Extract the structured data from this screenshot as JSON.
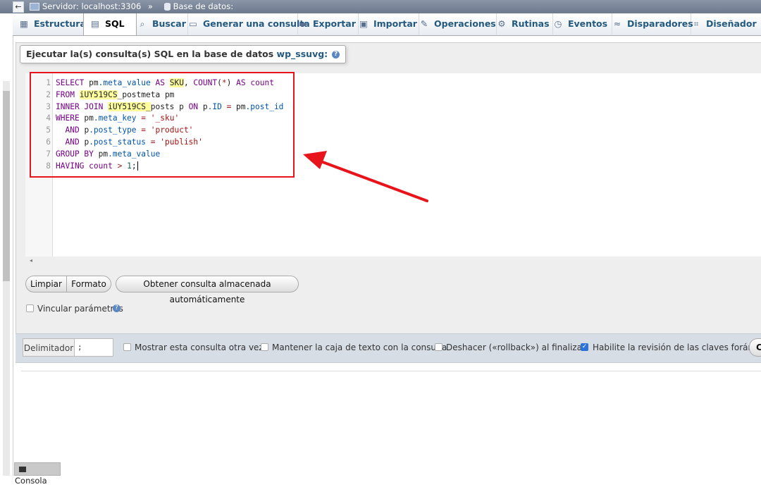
{
  "breadcrumb": {
    "server": "Servidor: localhost:3306",
    "separator": "»",
    "database": "Base de datos:"
  },
  "tabs": [
    {
      "label": "Estructura",
      "icon": "structure-icon"
    },
    {
      "label": "SQL",
      "icon": "sql-icon"
    },
    {
      "label": "Buscar",
      "icon": "search-icon"
    },
    {
      "label": "Generar una consulta",
      "icon": "query-builder-icon"
    },
    {
      "label": "Exportar",
      "icon": "export-icon"
    },
    {
      "label": "Importar",
      "icon": "import-icon"
    },
    {
      "label": "Operaciones",
      "icon": "wrench-icon"
    },
    {
      "label": "Rutinas",
      "icon": "routines-icon"
    },
    {
      "label": "Eventos",
      "icon": "clock-icon"
    },
    {
      "label": "Disparadores",
      "icon": "triggers-icon"
    },
    {
      "label": "Diseñador",
      "icon": "designer-icon"
    }
  ],
  "query_panel": {
    "legend_prefix": "Ejecutar la(s) consulta(s) SQL en la base de datos",
    "database_name": "wp_ssuvg:"
  },
  "editor": {
    "line_numbers": [
      "1",
      "2",
      "3",
      "4",
      "5",
      "6",
      "7",
      "8"
    ],
    "lines": [
      "SELECT pm.meta_value AS SKU, COUNT(*) AS count",
      "FROM iUY519CS_postmeta pm",
      "INNER JOIN iUY519CS_posts p ON p.ID = pm.post_id",
      "WHERE pm.meta_key = '_sku'",
      "  AND p.post_type = 'product'",
      "  AND p.post_status = 'publish'",
      "GROUP BY pm.meta_value",
      "HAVING count > 1;"
    ]
  },
  "buttons": {
    "clear": "Limpiar",
    "format": "Formato",
    "autosaved": "Obtener consulta almacenada automáticamente"
  },
  "bind_params": {
    "label": "Vincular parámetros",
    "checked": false
  },
  "options": {
    "delimiter_label": "Delimitador",
    "delimiter_value": ";",
    "show_again": {
      "label": "Mostrar esta consulta otra vez",
      "checked": false
    },
    "retain_box": {
      "label": "Mantener la caja de texto con la consulta",
      "checked": false
    },
    "rollback": {
      "label": "Deshacer («rollback») al finalizar",
      "checked": false
    },
    "foreign_keys": {
      "label": "Habilite la revisión de las claves foráneas",
      "checked": true
    },
    "go_button_partial": "C"
  },
  "console": {
    "label": "Consola"
  },
  "colors": {
    "annotation_red": "#e8141b",
    "link_blue": "#235a81",
    "checkbox_blue": "#2c72d8",
    "highlight_yellow": "#ffff9e"
  }
}
